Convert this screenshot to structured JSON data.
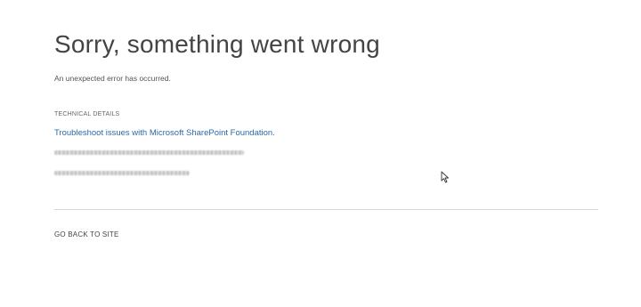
{
  "error": {
    "title": "Sorry, something went wrong",
    "message": "An unexpected error has occurred."
  },
  "technical_details": {
    "heading": "TECHNICAL DETAILS",
    "troubleshoot_link": "Troubleshoot issues with Microsoft SharePoint Foundation."
  },
  "footer": {
    "back_link": "GO BACK TO SITE"
  },
  "colors": {
    "link": "#2a6aa8",
    "title": "#444444",
    "divider": "#d8d8d8"
  },
  "icons": {
    "cursor": "mouse-pointer-icon"
  }
}
